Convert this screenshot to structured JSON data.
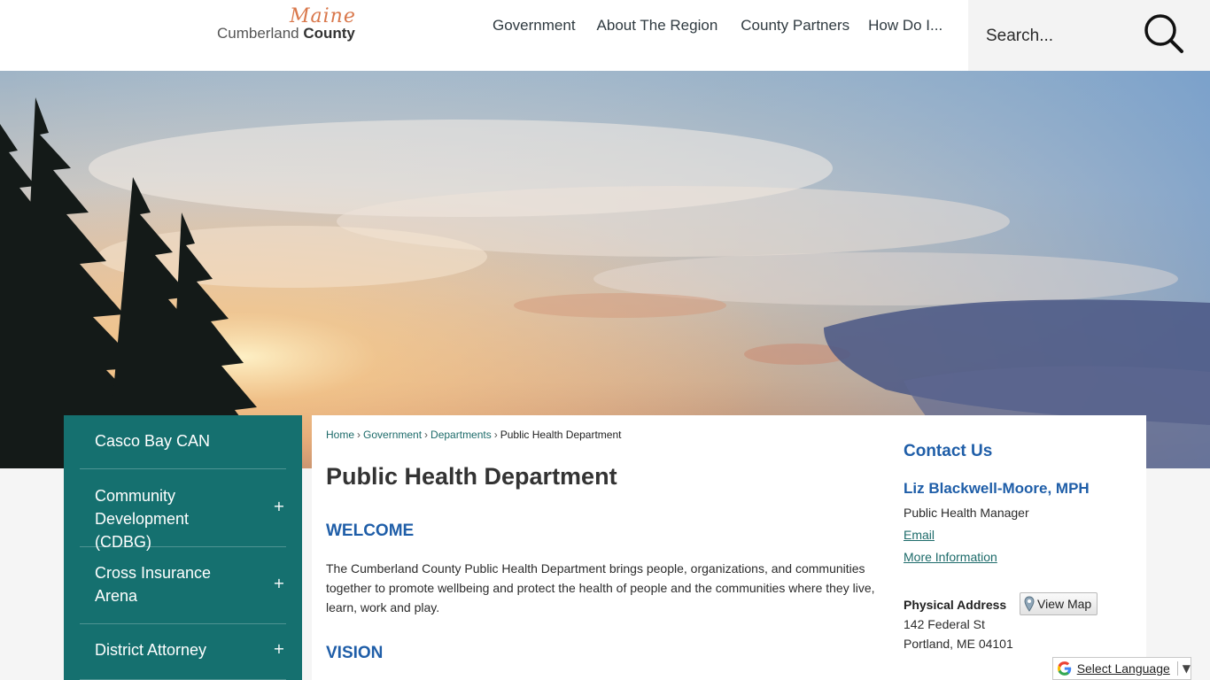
{
  "header": {
    "logo_script": "Maine",
    "logo_light": "Cumberland",
    "logo_bold": "County",
    "nav": [
      "Government",
      "About The Region",
      "County Partners",
      "How Do I..."
    ],
    "search": {
      "placeholder": "Search...",
      "icon": "search-icon"
    }
  },
  "sidebar": {
    "items": [
      {
        "label": "Casco Bay CAN",
        "expandable": false
      },
      {
        "label": "Community Development (CDBG)",
        "expandable": true
      },
      {
        "label": "Cross Insurance Arena",
        "expandable": true
      },
      {
        "label": "District Attorney",
        "expandable": true
      }
    ],
    "expand_glyph": "+",
    "bg_color": "#15706f"
  },
  "breadcrumb": {
    "items": [
      "Home",
      "Government",
      "Departments"
    ],
    "current": "Public Health Department",
    "separator": "›"
  },
  "main": {
    "title": "Public Health Department",
    "welcome_heading": "WELCOME",
    "welcome_text": "The Cumberland County Public Health Department brings people, organizations, and communities together to promote wellbeing and protect the health of people and the communities where they live, learn, work and play.",
    "vision_heading": "VISION"
  },
  "contact": {
    "heading": "Contact Us",
    "name": "Liz Blackwell-Moore, MPH",
    "role": "Public Health Manager",
    "email_link": "Email",
    "more_link": "More Information",
    "address_label": "Physical Address",
    "view_map": "View Map",
    "address_line1": "142 Federal St",
    "address_line2": "Portland, ME 04101"
  },
  "translate": {
    "label": "Select Language",
    "arrow": "▼",
    "icon": "google-g-icon"
  },
  "colors": {
    "accent_teal": "#15706f",
    "heading_blue": "#1f5ea8",
    "logo_orange": "#d9784c"
  }
}
